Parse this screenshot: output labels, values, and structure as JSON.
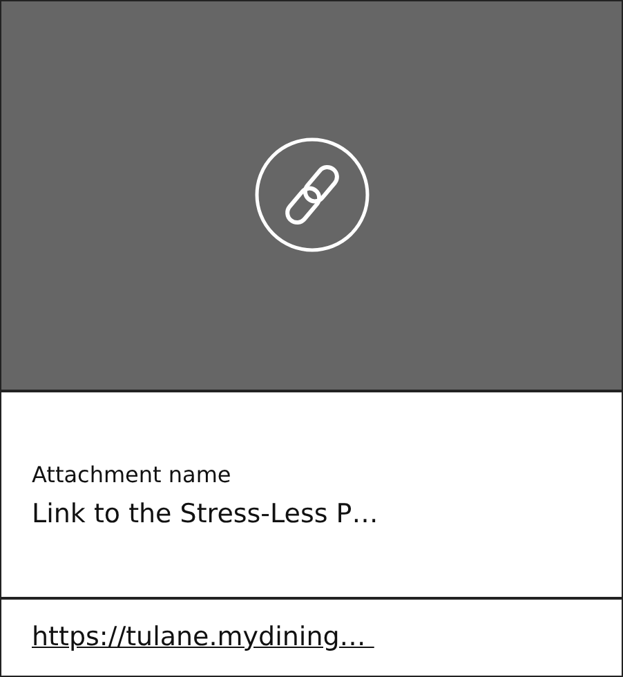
{
  "preview": {
    "kind": "link"
  },
  "attachment": {
    "label": "Attachment name",
    "name": "Link to the Stress-Less P…"
  },
  "link": {
    "text": "https://tulane.mydining… "
  }
}
